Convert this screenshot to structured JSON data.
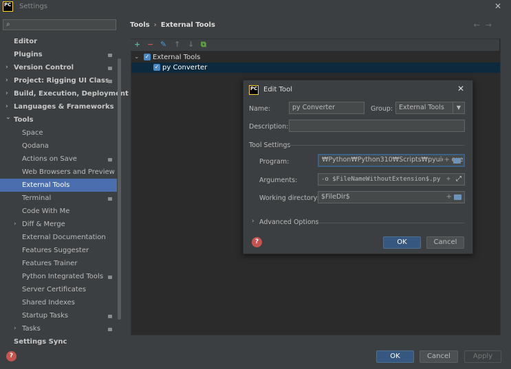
{
  "window": {
    "title": "Settings",
    "app_icon": "PC"
  },
  "search": {
    "placeholder": "",
    "icon": "search-icon"
  },
  "sidebar": {
    "items": [
      {
        "label": "Editor",
        "bold": true,
        "chevron": false,
        "badge": false,
        "indent": 0
      },
      {
        "label": "Plugins",
        "bold": true,
        "chevron": false,
        "badge": true,
        "indent": 0
      },
      {
        "label": "Version Control",
        "bold": true,
        "chevron": true,
        "badge": true,
        "indent": 0
      },
      {
        "label": "Project: Rigging UI Class",
        "bold": true,
        "chevron": true,
        "badge": true,
        "indent": 0
      },
      {
        "label": "Build, Execution, Deployment",
        "bold": true,
        "chevron": true,
        "badge": false,
        "indent": 0
      },
      {
        "label": "Languages & Frameworks",
        "bold": true,
        "chevron": true,
        "badge": false,
        "indent": 0
      },
      {
        "label": "Tools",
        "bold": true,
        "chevron": "open",
        "badge": false,
        "indent": 0
      },
      {
        "label": "Space",
        "bold": false,
        "chevron": false,
        "badge": false,
        "indent": 1
      },
      {
        "label": "Qodana",
        "bold": false,
        "chevron": false,
        "badge": false,
        "indent": 1
      },
      {
        "label": "Actions on Save",
        "bold": false,
        "chevron": false,
        "badge": true,
        "indent": 1
      },
      {
        "label": "Web Browsers and Preview",
        "bold": false,
        "chevron": false,
        "badge": false,
        "indent": 1
      },
      {
        "label": "External Tools",
        "bold": false,
        "chevron": false,
        "badge": false,
        "indent": 1,
        "selected": true
      },
      {
        "label": "Terminal",
        "bold": false,
        "chevron": false,
        "badge": true,
        "indent": 1
      },
      {
        "label": "Code With Me",
        "bold": false,
        "chevron": false,
        "badge": false,
        "indent": 1
      },
      {
        "label": "Diff & Merge",
        "bold": false,
        "chevron": true,
        "badge": false,
        "indent": 1
      },
      {
        "label": "External Documentation",
        "bold": false,
        "chevron": false,
        "badge": false,
        "indent": 1
      },
      {
        "label": "Features Suggester",
        "bold": false,
        "chevron": false,
        "badge": false,
        "indent": 1
      },
      {
        "label": "Features Trainer",
        "bold": false,
        "chevron": false,
        "badge": false,
        "indent": 1
      },
      {
        "label": "Python Integrated Tools",
        "bold": false,
        "chevron": false,
        "badge": true,
        "indent": 1
      },
      {
        "label": "Server Certificates",
        "bold": false,
        "chevron": false,
        "badge": false,
        "indent": 1
      },
      {
        "label": "Shared Indexes",
        "bold": false,
        "chevron": false,
        "badge": false,
        "indent": 1
      },
      {
        "label": "Startup Tasks",
        "bold": false,
        "chevron": false,
        "badge": true,
        "indent": 1
      },
      {
        "label": "Tasks",
        "bold": false,
        "chevron": true,
        "badge": true,
        "indent": 1
      },
      {
        "label": "Settings Sync",
        "bold": true,
        "chevron": false,
        "badge": false,
        "indent": 0
      }
    ]
  },
  "breadcrumb": {
    "parent": "Tools",
    "separator": "›",
    "current": "External Tools",
    "back": "←",
    "forward": "→"
  },
  "toolbar": {
    "add": "+",
    "remove": "−",
    "edit": "✎",
    "up": "↑",
    "down": "↓",
    "copy": "⧉"
  },
  "tree": {
    "group": {
      "label": "External Tools",
      "checked": true
    },
    "items": [
      {
        "label": "py Converter",
        "checked": true
      }
    ]
  },
  "dialog": {
    "title": "Edit Tool",
    "name_label": "Name:",
    "name_value": "py Converter",
    "group_label": "Group:",
    "group_value": "External Tools",
    "description_label": "Description:",
    "description_value": "",
    "tool_settings_label": "Tool Settings",
    "program_label": "Program:",
    "program_value": "₩Python₩Python310₩Scripts₩pyuic5.exe",
    "arguments_label": "Arguments:",
    "arguments_value": "-o $FileNameWithoutExtension$.py",
    "workdir_label": "Working directory:",
    "workdir_value": "$FileDir$",
    "advanced_label": "Advanced Options",
    "ok": "OK",
    "cancel": "Cancel",
    "help": "?"
  },
  "footer": {
    "ok": "OK",
    "cancel": "Cancel",
    "apply": "Apply",
    "help": "?"
  },
  "colors": {
    "selection": "#4b6eaf",
    "tree_selection": "#0d293e",
    "primary_button": "#365880",
    "help": "#c75450",
    "checkbox": "#4a88c7"
  }
}
